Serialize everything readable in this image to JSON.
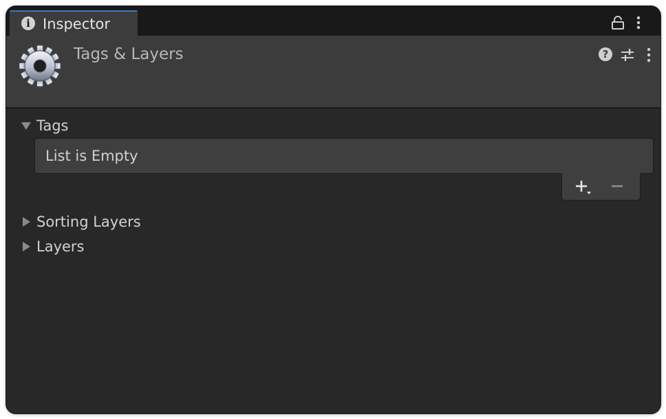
{
  "window": {
    "tab": {
      "label": "Inspector",
      "icon": "info-icon",
      "icon_glyph": "i"
    },
    "tab_actions": [
      "lock-icon",
      "tab-menu-icon"
    ]
  },
  "header": {
    "title": "Tags & Layers",
    "icon": "gear-icon",
    "actions": {
      "help_glyph": "?",
      "icons": [
        "help-icon",
        "preset-icon",
        "header-menu-icon"
      ]
    }
  },
  "sections": {
    "tags": {
      "label": "Tags",
      "expanded": true,
      "empty_text": "List is Empty",
      "buttons": [
        "add-icon",
        "remove-icon"
      ]
    },
    "sorting_layers": {
      "label": "Sorting Layers",
      "expanded": false
    },
    "layers": {
      "label": "Layers",
      "expanded": false
    }
  },
  "colors": {
    "tab_accent": "#3a79bb",
    "panel_bg": "#282828",
    "header_bg": "#3c3c3c",
    "text": "#d2d2d2"
  }
}
